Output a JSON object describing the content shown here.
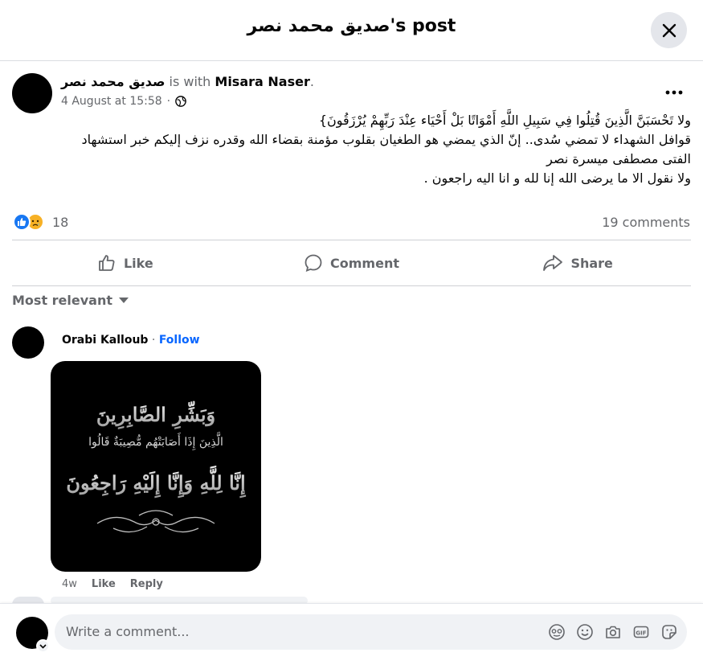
{
  "header": {
    "title": "صديق محمد نصر's post"
  },
  "post": {
    "author": "صديق محمد نصر",
    "with_text": " is with ",
    "tagged": "Misara Naser",
    "tagged_suffix": ".",
    "timestamp": "4 August at 15:58",
    "dot": "·",
    "text_lines": [
      "ولا تَحْسَبَنَّ الَّذِينَ قُتِلُوا فِي سَبِيلِ اللَّهِ أَمْوَاتًا بَلْ أَحْيَاء عِنْدَ رَبِّهِمْ يُرْزَقُونَ}",
      "قوافل الشهداء لا تمضي سُدى.. إنّ الذي يمضي هو الطغيان بقلوب مؤمنة بقضاء الله وقدره نزف إليكم خبر استشهاد",
      "الفتى مصطفى ميسرة نصر",
      "ولا نقول الا ما يرضى الله إنا لله و انا اليه راجعون ."
    ],
    "reaction_count": "18",
    "comments_count": "19 comments"
  },
  "actions": {
    "like": "Like",
    "comment": "Comment",
    "share": "Share"
  },
  "sort": {
    "label": "Most relevant"
  },
  "comment": {
    "name": "Orabi Kalloub",
    "dot": "·",
    "follow": "Follow",
    "image_lines": [
      "وَبَشِّرِ الصَّابِرِينَ",
      "الَّذِينَ إِذَا أَصَابَتْهُم مُّصِيبَةٌ قَالُوا",
      "إِنَّا لِلَّهِ وَإِنَّا إِلَيْهِ رَاجِعُونَ"
    ],
    "age": "4w",
    "like": "Like",
    "reply": "Reply"
  },
  "composer": {
    "placeholder": "Write a comment...",
    "icons": [
      "avatar-sticker-icon",
      "emoji-icon",
      "camera-icon",
      "gif-icon",
      "sticker-icon"
    ]
  },
  "colors": {
    "accent": "#0866ff",
    "secondary_text": "#65676b",
    "like_blue": "#1877f2",
    "sad_yellow": "#f7b125"
  }
}
